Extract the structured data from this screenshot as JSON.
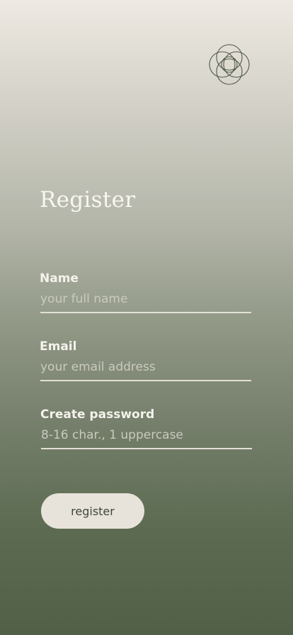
{
  "colors": {
    "gradient_top": "#eeeae3",
    "gradient_bottom": "#526048",
    "text_light": "#f4f2ec",
    "placeholder": "#c9cabf",
    "underline": "#e3e0d6",
    "button_bg": "#e7e3da",
    "button_text": "#3f4737",
    "logo_stroke": "#4f5a47"
  },
  "logo": {
    "icon": "flower-of-life-icon"
  },
  "page": {
    "title": "Register"
  },
  "form": {
    "name": {
      "label": "Name",
      "value": "",
      "placeholder": "your full name"
    },
    "email": {
      "label": "Email",
      "value": "",
      "placeholder": "your email address"
    },
    "password": {
      "label": "Create password",
      "value": "",
      "placeholder": "8-16 char., 1 uppercase"
    },
    "submit_label": "register"
  }
}
